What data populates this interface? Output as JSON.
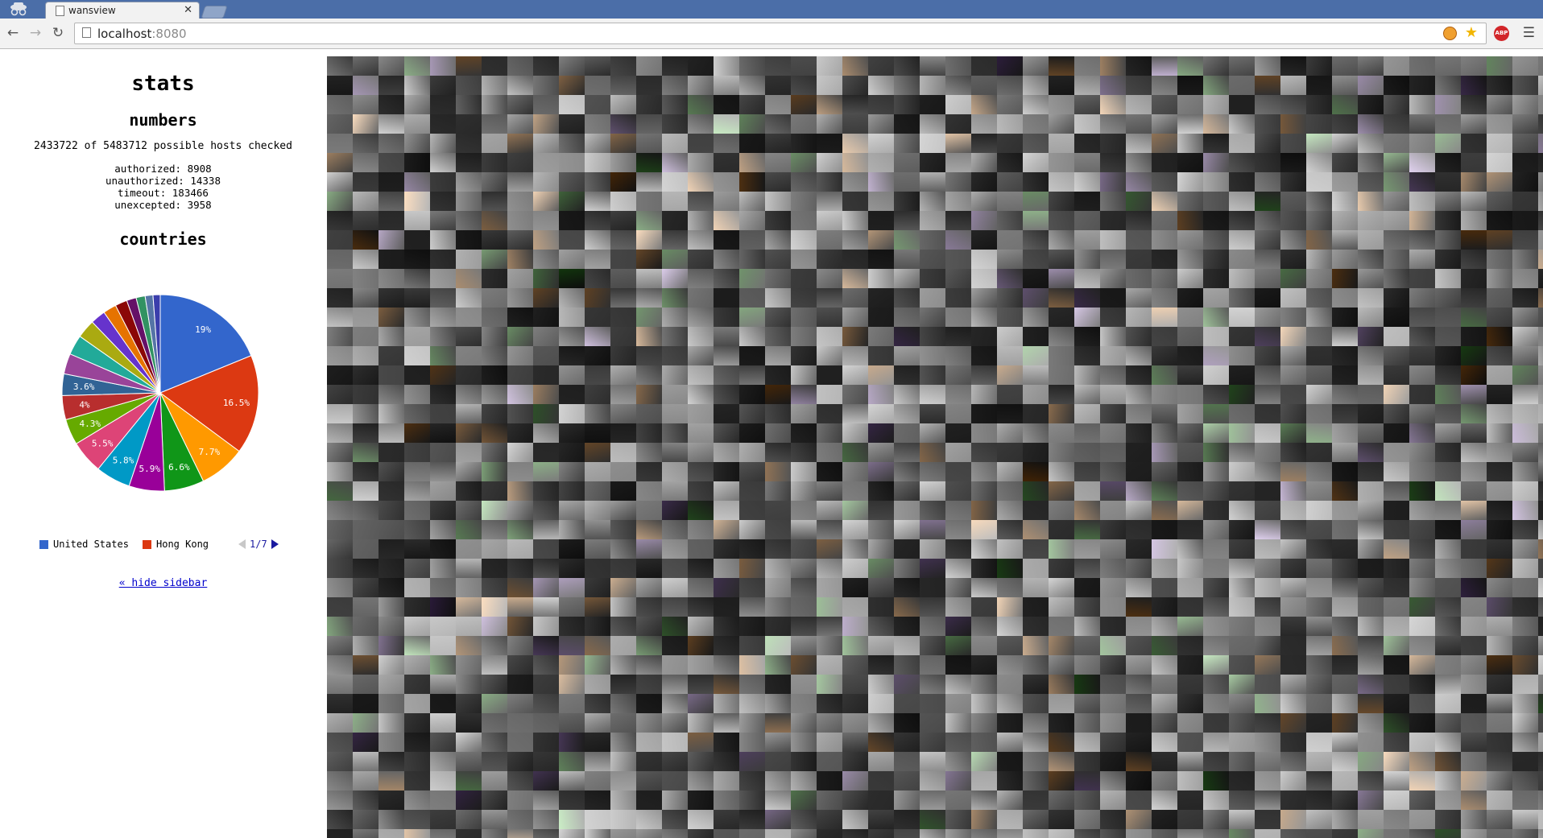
{
  "browser": {
    "tab_title": "wansview",
    "url_host": "localhost",
    "url_port": ":8080",
    "extensions": [
      "key-icon",
      "star-icon",
      "abp-icon"
    ],
    "abp_label": "ABP"
  },
  "sidebar": {
    "title": "stats",
    "numbers_heading": "numbers",
    "hosts_checked": "2433722 of 5483712 possible hosts checked",
    "counts": [
      "authorized: 8908",
      "unauthorized: 14338",
      "timeout: 183466",
      "unexcepted: 3958"
    ],
    "countries_heading": "countries",
    "legend": [
      {
        "label": "United States",
        "color": "#3366cc"
      },
      {
        "label": "Hong Kong",
        "color": "#dc3912"
      }
    ],
    "pager": "1/7",
    "hide_link": "« hide sidebar"
  },
  "chart_data": {
    "type": "pie",
    "title": "",
    "series": [
      {
        "name": "United States",
        "percent": 19,
        "label": "19%",
        "color": "#3366cc"
      },
      {
        "name": "Hong Kong",
        "percent": 16.5,
        "label": "16.5%",
        "color": "#dc3912"
      },
      {
        "percent": 7.7,
        "label": "7.7%",
        "color": "#ff9900"
      },
      {
        "percent": 6.6,
        "label": "6.6%",
        "color": "#109618"
      },
      {
        "percent": 5.9,
        "label": "5.9%",
        "color": "#990099"
      },
      {
        "percent": 5.8,
        "label": "5.8%",
        "color": "#0099c6"
      },
      {
        "percent": 5.5,
        "label": "5.5%",
        "color": "#dd4477"
      },
      {
        "percent": 4.3,
        "label": "4.3%",
        "color": "#66aa00"
      },
      {
        "percent": 4,
        "label": "4%",
        "color": "#b82e2e"
      },
      {
        "percent": 3.6,
        "label": "3.6%",
        "color": "#316395"
      },
      {
        "percent": 3.4,
        "label": "",
        "color": "#994499"
      },
      {
        "percent": 3.3,
        "label": "",
        "color": "#22aa99"
      },
      {
        "percent": 3.1,
        "label": "",
        "color": "#aaaa11"
      },
      {
        "percent": 2.5,
        "label": "",
        "color": "#6633cc"
      },
      {
        "percent": 2.2,
        "label": "",
        "color": "#e67300"
      },
      {
        "percent": 2,
        "label": "",
        "color": "#8b0707"
      },
      {
        "percent": 1.6,
        "label": "",
        "color": "#651067"
      },
      {
        "percent": 1.5,
        "label": "",
        "color": "#329262"
      },
      {
        "percent": 1.3,
        "label": "",
        "color": "#5574a6"
      },
      {
        "percent": 1.2,
        "label": "",
        "color": "#3b3eac"
      }
    ]
  }
}
